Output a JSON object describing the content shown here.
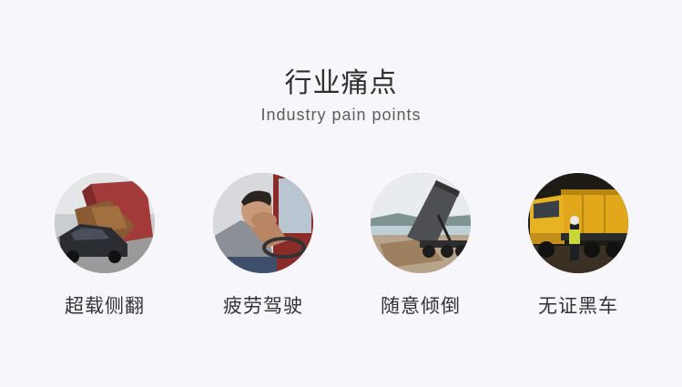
{
  "header": {
    "title": "行业痛点",
    "subtitle": "Industry pain points"
  },
  "items": [
    {
      "label": "超载侧翻",
      "image": "overturned-truck-image"
    },
    {
      "label": "疲劳驾驶",
      "image": "tired-driver-image"
    },
    {
      "label": "随意倾倒",
      "image": "dump-truck-unloading-image"
    },
    {
      "label": "无证黑车",
      "image": "yellow-dump-truck-night-image"
    }
  ]
}
